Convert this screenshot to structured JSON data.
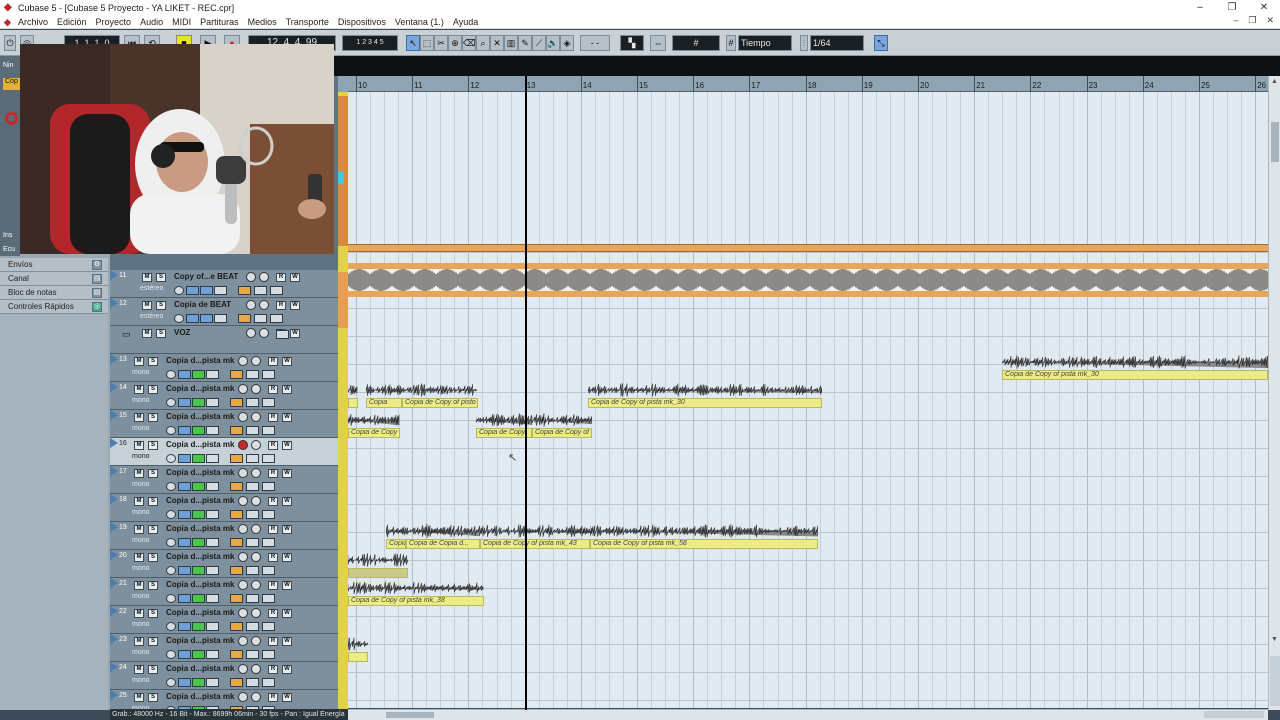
{
  "window": {
    "title": "Cubase 5 - [Cubase 5 Proyecto - YA LIKET - REC.cpr]",
    "minimize": "–",
    "maximize": "❐",
    "close": "✕"
  },
  "menu": {
    "items": [
      "Archivo",
      "Edición",
      "Proyecto",
      "Audio",
      "MIDI",
      "Partituras",
      "Medios",
      "Transporte",
      "Dispositivos",
      "Ventana (1.)",
      "Ayuda"
    ],
    "right_controls": [
      "–",
      "❐",
      "✕"
    ]
  },
  "toolbar": {
    "position_left": "1. 1. 1. 0",
    "position_right": "12. 4. 4. 99",
    "quantize_type": "Tiempo",
    "quantize_value": "1/64",
    "snap_value": "-  -"
  },
  "inspector": {
    "items": [
      "Envíos",
      "Canal",
      "Bloc de notas",
      "Controles Rápidos"
    ],
    "top_labels": [
      "Nin",
      "Cop",
      "Ins",
      "Ecu"
    ]
  },
  "tracks": [
    {
      "number": "11",
      "name": "Copy of...e BEAT",
      "subtitle": "estéreo",
      "type": "stereo"
    },
    {
      "number": "12",
      "name": "Copia de BEAT",
      "subtitle": "estéreo",
      "type": "stereo"
    },
    {
      "number": "",
      "name": "VOZ",
      "subtitle": "",
      "type": "folder"
    },
    {
      "number": "13",
      "name": "Copia d...pista mk",
      "subtitle": "mono",
      "type": "mono"
    },
    {
      "number": "14",
      "name": "Copia d...pista mk",
      "subtitle": "mono",
      "type": "mono"
    },
    {
      "number": "15",
      "name": "Copia d...pista mk",
      "subtitle": "mono",
      "type": "mono"
    },
    {
      "number": "16",
      "name": "Copia d...pista mk",
      "subtitle": "mono",
      "type": "mono",
      "selected": true,
      "recording": true
    },
    {
      "number": "17",
      "name": "Copia d...pista mk",
      "subtitle": "mono",
      "type": "mono"
    },
    {
      "number": "18",
      "name": "Copia d...pista mk",
      "subtitle": "mono",
      "type": "mono"
    },
    {
      "number": "19",
      "name": "Copia d...pista mk",
      "subtitle": "mono",
      "type": "mono"
    },
    {
      "number": "20",
      "name": "Copia d...pista mk",
      "subtitle": "mono",
      "type": "mono"
    },
    {
      "number": "21",
      "name": "Copia d...pista mk",
      "subtitle": "mono",
      "type": "mono"
    },
    {
      "number": "22",
      "name": "Copia d...pista mk",
      "subtitle": "mono",
      "type": "mono"
    },
    {
      "number": "23",
      "name": "Copia d...pista mk",
      "subtitle": "mono",
      "type": "mono"
    },
    {
      "number": "24",
      "name": "Copia d...pista mk",
      "subtitle": "mono",
      "type": "mono"
    },
    {
      "number": "25",
      "name": "Copia d...pista mk",
      "subtitle": "mono",
      "type": "mono"
    }
  ],
  "ruler": {
    "bars": [
      "10",
      "11",
      "12",
      "13",
      "14",
      "15",
      "16",
      "17",
      "18",
      "19",
      "20",
      "21",
      "22",
      "23",
      "24",
      "25",
      "26"
    ]
  },
  "parts": {
    "p13": "Copia de Copy of pista mk_30",
    "p14a": "Copia",
    "p14b": "Copia de Copy of pisto",
    "p14c": "Copia de Copy of pista mk_30",
    "p15a": "Copia de Copy",
    "p15b": "Copia de Copy",
    "p15c": "Copia de Copy of",
    "p19a": "Copia",
    "p19b": "Copia de Copia d...",
    "p19c": "Copia de Copy of pista mk_43",
    "p19d": "Copia de Copy of pista mk_58",
    "p21": "Copia de Copy of pista mk_38"
  },
  "status": {
    "text": "Grab.: 48000 Hz - 16 Bit - Max.: 8699h 06min - 30 fps - Pan : Igual Energía"
  },
  "colors": {
    "accent": "#4a7fb0",
    "record": "#c8272d",
    "part_label": "#ecec86",
    "beat_track": "#e8a65a"
  }
}
